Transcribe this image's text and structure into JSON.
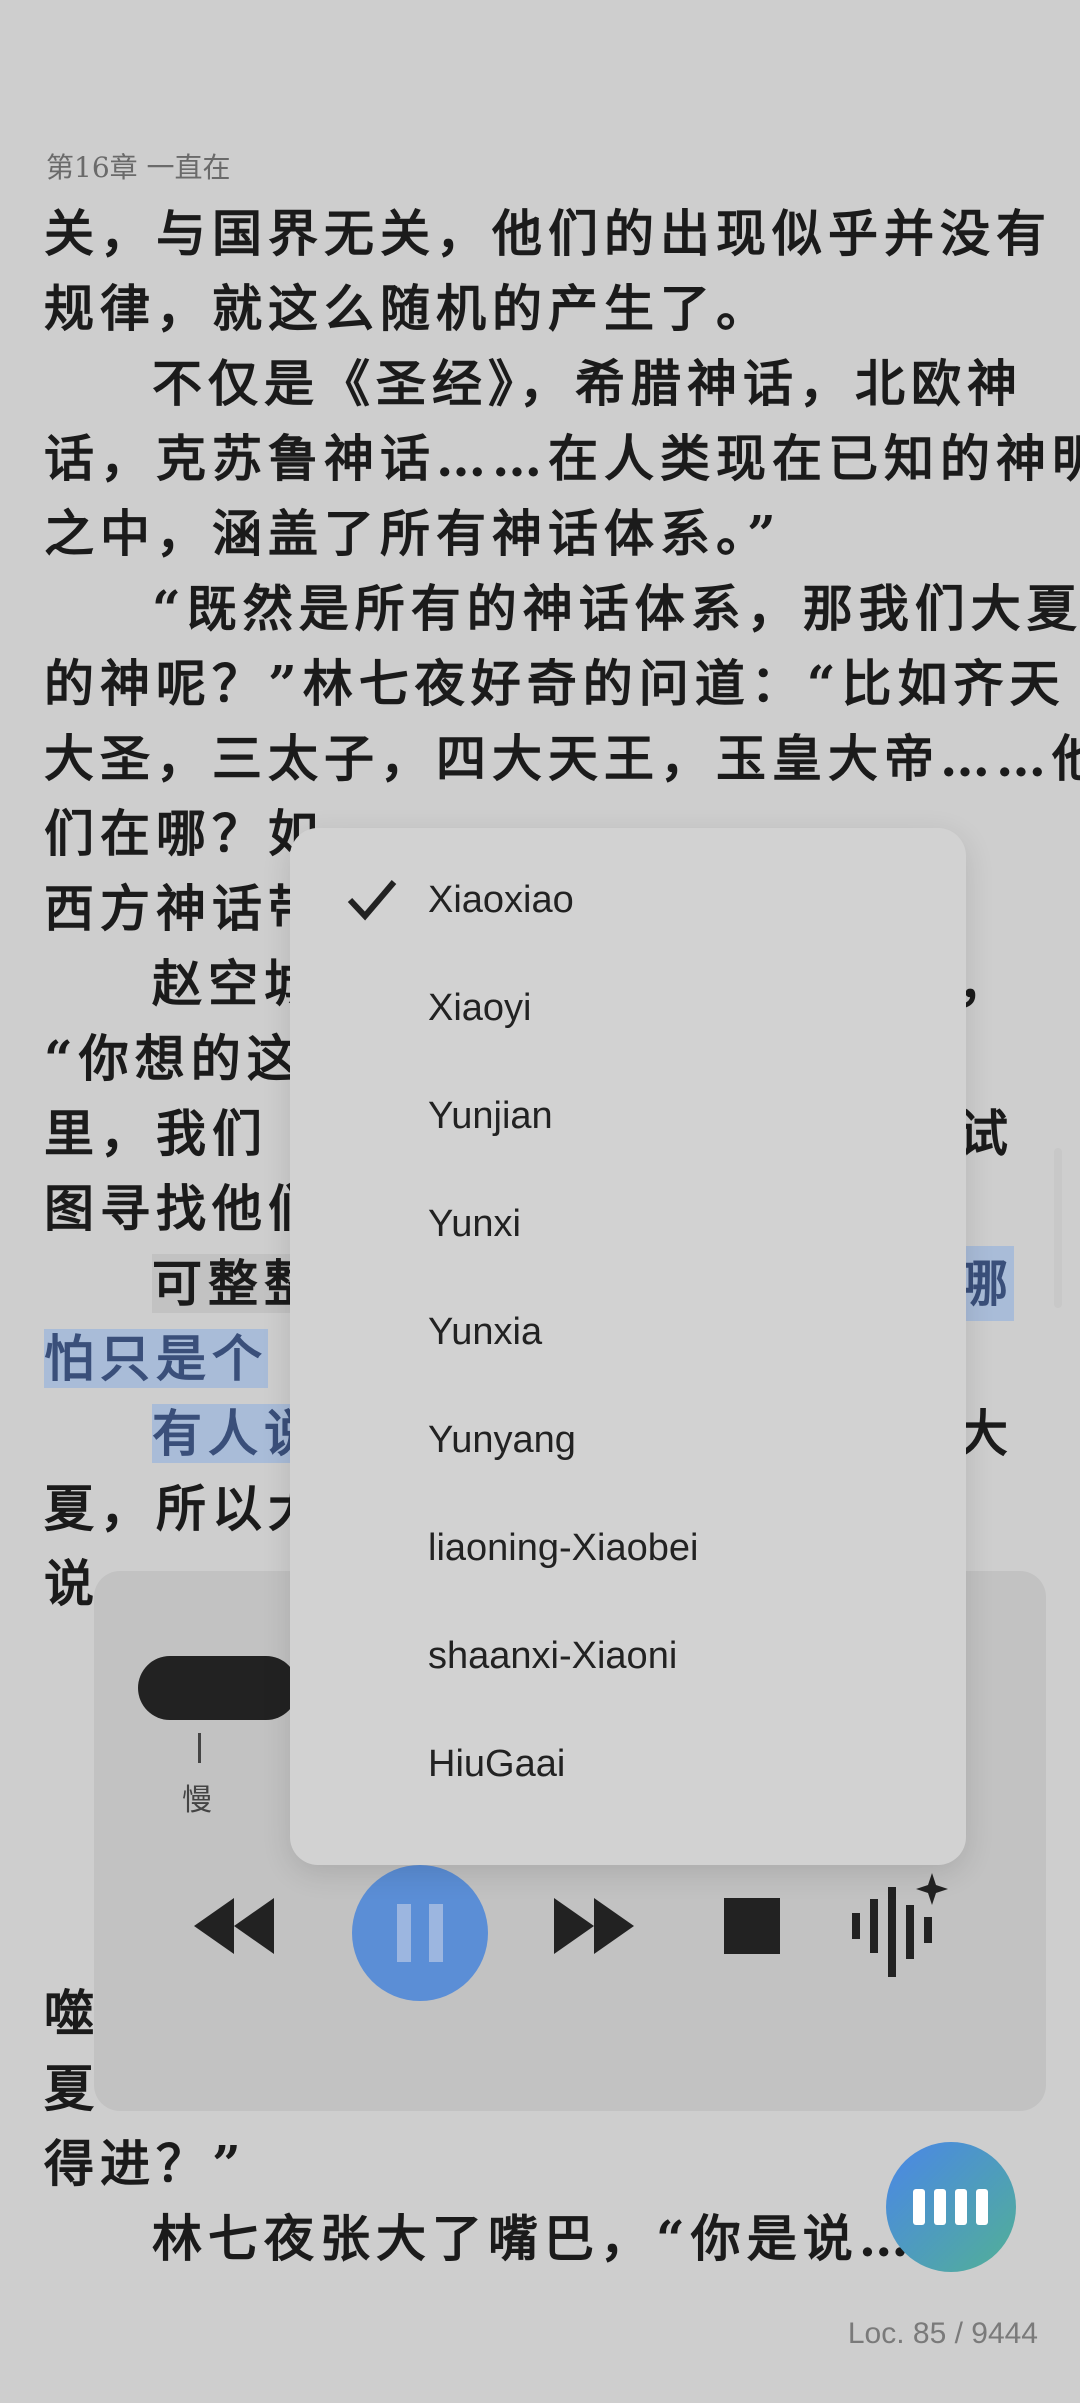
{
  "chapter_title": "第16章 一直在",
  "reader_lines": [
    {
      "text": "关，与国界无关，他们的出现似乎并没有",
      "indent": false,
      "hl": ""
    },
    {
      "text": "规律，就这么随机的产生了。",
      "indent": false,
      "hl": ""
    },
    {
      "text": "不仅是《圣经》，希腊神话，北欧神",
      "indent": true,
      "hl": ""
    },
    {
      "text": "话，克苏鲁神话……在人类现在已知的神明",
      "indent": false,
      "hl": ""
    },
    {
      "text": "之中，涵盖了所有神话体系。”",
      "indent": false,
      "hl": ""
    },
    {
      "text": "“既然是所有的神话体系，那我们大夏",
      "indent": true,
      "hl": ""
    },
    {
      "text": "的神呢？”林七夜好奇的问道：“比如齐天",
      "indent": false,
      "hl": ""
    },
    {
      "text": "大圣，三太子，四大天王，玉皇大帝……他",
      "indent": false,
      "hl": ""
    },
    {
      "text": "们在哪？如",
      "indent": false,
      "hl": ""
    },
    {
      "text": "西方神话带",
      "indent": false,
      "hl": ""
    },
    {
      "text": "赵空城",
      "indent": true,
      "hl": ""
    },
    {
      "text": "“你想的这",
      "indent": false,
      "hl": ""
    },
    {
      "text": "里，我们",
      "indent": false,
      "hl": ""
    },
    {
      "text": "图寻找他们",
      "indent": false,
      "hl": ""
    },
    {
      "text": "可整整",
      "indent": true,
      "hl": "gray"
    },
    {
      "text": "怕只是个",
      "indent": false,
      "hl": "blue"
    },
    {
      "text": "有人说",
      "indent": true,
      "hl": "blue"
    },
    {
      "text": "夏，所以大",
      "indent": false,
      "hl": ""
    },
    {
      "text": "说",
      "indent": false,
      "hl": ""
    }
  ],
  "right_fragments": [
    {
      "text": "，",
      "line": 10
    },
    {
      "text": "试",
      "line": 12
    },
    {
      "text": "哪",
      "line": 14
    },
    {
      "text": "大",
      "line": 16
    }
  ],
  "bottom_lines": [
    {
      "text": "噬",
      "indent": false
    },
    {
      "text": "夏",
      "indent": false
    },
    {
      "text": "得进？”",
      "indent": false
    },
    {
      "text": "林七夜张大了嘴巴，“你是说……",
      "indent": true
    }
  ],
  "location": "Loc. 85 / 9444",
  "player": {
    "speed_label": "慢",
    "icons": [
      "rewind-icon",
      "pause-icon",
      "fast-forward-icon",
      "stop-icon",
      "ai-voice-icon"
    ]
  },
  "voice_menu": {
    "selected": "Xiaoxiao",
    "items": [
      "Xiaoxiao",
      "Xiaoyi",
      "Yunjian",
      "Yunxi",
      "Yunxia",
      "Yunyang",
      "liaoning-Xiaobei",
      "shaanxi-Xiaoni",
      "HiuGaai"
    ]
  },
  "colors": {
    "accent_blue": "#5b8ed6",
    "highlight_blue": "#a9bcd8",
    "highlight_gray": "#c2c2c2",
    "fab_gradient_start": "#4a86e8",
    "fab_gradient_end": "#52b096"
  }
}
